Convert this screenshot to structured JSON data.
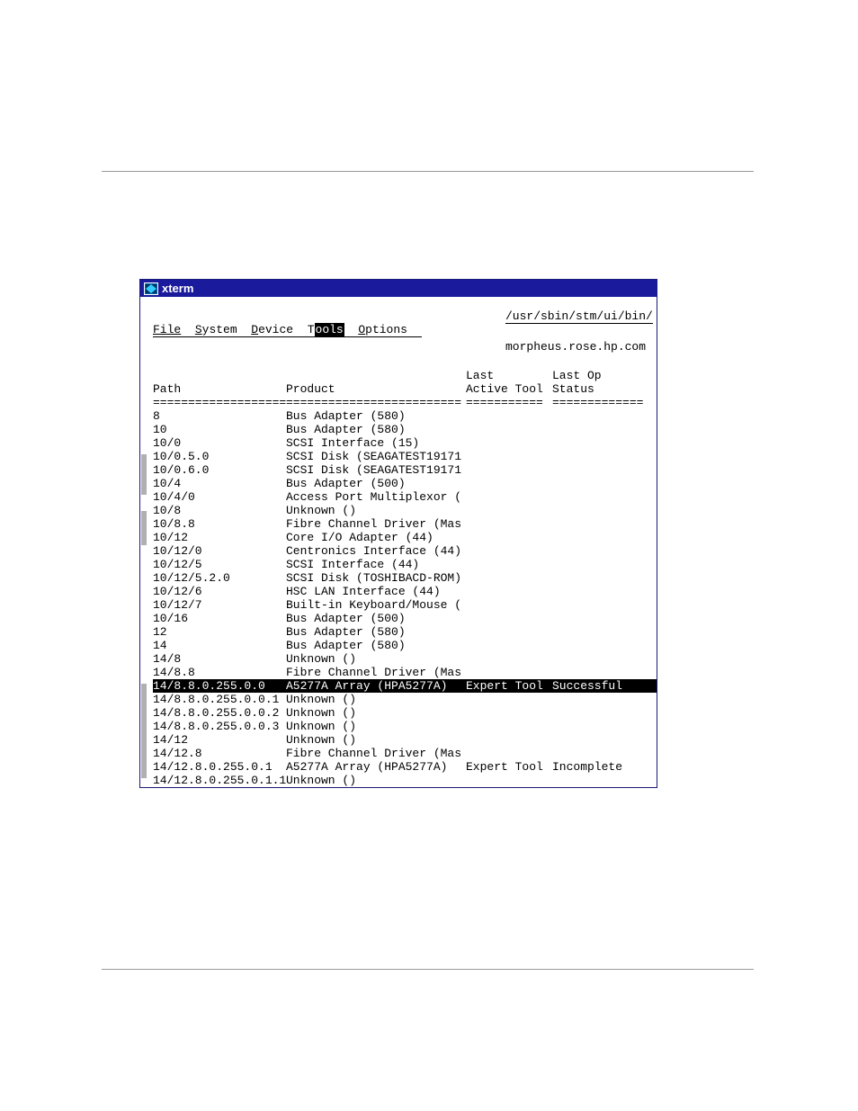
{
  "window": {
    "title": "xterm",
    "process_path": "/usr/sbin/stm/ui/bin/s",
    "hostname": "morpheus.rose.hp.com"
  },
  "menu": {
    "file": "File",
    "system": "System",
    "device": "Device",
    "tools": "Tools",
    "options": "Options"
  },
  "headers": {
    "path": "Path",
    "product": "Product",
    "last_tool_l1": "Last",
    "last_tool_l2": "Active Tool",
    "last_op_l1": "Last Op",
    "last_op_l2": "Status"
  },
  "rows": [
    {
      "path": "8",
      "product": "Bus Adapter (580)",
      "tool": "",
      "status": "",
      "sel": false
    },
    {
      "path": "10",
      "product": "Bus Adapter (580)",
      "tool": "",
      "status": "",
      "sel": false
    },
    {
      "path": "10/0",
      "product": "SCSI Interface (15)",
      "tool": "",
      "status": "",
      "sel": false
    },
    {
      "path": "10/0.5.0",
      "product": "SCSI Disk (SEAGATEST19171",
      "tool": "",
      "status": "",
      "sel": false
    },
    {
      "path": "10/0.6.0",
      "product": "SCSI Disk (SEAGATEST19171",
      "tool": "",
      "status": "",
      "sel": false
    },
    {
      "path": "10/4",
      "product": "Bus Adapter (500)",
      "tool": "",
      "status": "",
      "sel": false
    },
    {
      "path": "10/4/0",
      "product": "Access Port Multiplexor (",
      "tool": "",
      "status": "",
      "sel": false
    },
    {
      "path": "10/8",
      "product": "Unknown ()",
      "tool": "",
      "status": "",
      "sel": false
    },
    {
      "path": "10/8.8",
      "product": "Fibre Channel Driver (Mas",
      "tool": "",
      "status": "",
      "sel": false
    },
    {
      "path": "10/12",
      "product": "Core I/O Adapter (44)",
      "tool": "",
      "status": "",
      "sel": false
    },
    {
      "path": "10/12/0",
      "product": "Centronics Interface (44)",
      "tool": "",
      "status": "",
      "sel": false
    },
    {
      "path": "10/12/5",
      "product": "SCSI Interface (44)",
      "tool": "",
      "status": "",
      "sel": false
    },
    {
      "path": "10/12/5.2.0",
      "product": "SCSI Disk (TOSHIBACD-ROM)",
      "tool": "",
      "status": "",
      "sel": false
    },
    {
      "path": "10/12/6",
      "product": "HSC LAN Interface (44)",
      "tool": "",
      "status": "",
      "sel": false
    },
    {
      "path": "10/12/7",
      "product": "Built-in Keyboard/Mouse (",
      "tool": "",
      "status": "",
      "sel": false
    },
    {
      "path": "10/16",
      "product": "Bus Adapter (500)",
      "tool": "",
      "status": "",
      "sel": false
    },
    {
      "path": "12",
      "product": "Bus Adapter (580)",
      "tool": "",
      "status": "",
      "sel": false
    },
    {
      "path": "14",
      "product": "Bus Adapter (580)",
      "tool": "",
      "status": "",
      "sel": false
    },
    {
      "path": "14/8",
      "product": "Unknown ()",
      "tool": "",
      "status": "",
      "sel": false
    },
    {
      "path": "14/8.8",
      "product": "Fibre Channel Driver (Mas",
      "tool": "",
      "status": "",
      "sel": false
    },
    {
      "path": "14/8.8.0.255.0.0",
      "product": "A5277A Array (HPA5277A)",
      "tool": "Expert Tool",
      "status": "Successful",
      "sel": true
    },
    {
      "path": "14/8.8.0.255.0.0.1",
      "product": "Unknown ()",
      "tool": "",
      "status": "",
      "sel": false
    },
    {
      "path": "14/8.8.0.255.0.0.2",
      "product": "Unknown ()",
      "tool": "",
      "status": "",
      "sel": false
    },
    {
      "path": "14/8.8.0.255.0.0.3",
      "product": "Unknown ()",
      "tool": "",
      "status": "",
      "sel": false
    },
    {
      "path": "14/12",
      "product": "Unknown ()",
      "tool": "",
      "status": "",
      "sel": false
    },
    {
      "path": "14/12.8",
      "product": "Fibre Channel Driver (Mas",
      "tool": "",
      "status": "",
      "sel": false
    },
    {
      "path": "14/12.8.0.255.0.1",
      "product": "A5277A Array (HPA5277A)",
      "tool": "Expert Tool",
      "status": "Incomplete",
      "sel": false
    },
    {
      "path": "14/12.8.0.255.0.1.1",
      "product": "Unknown ()",
      "tool": "",
      "status": "",
      "sel": false
    }
  ]
}
